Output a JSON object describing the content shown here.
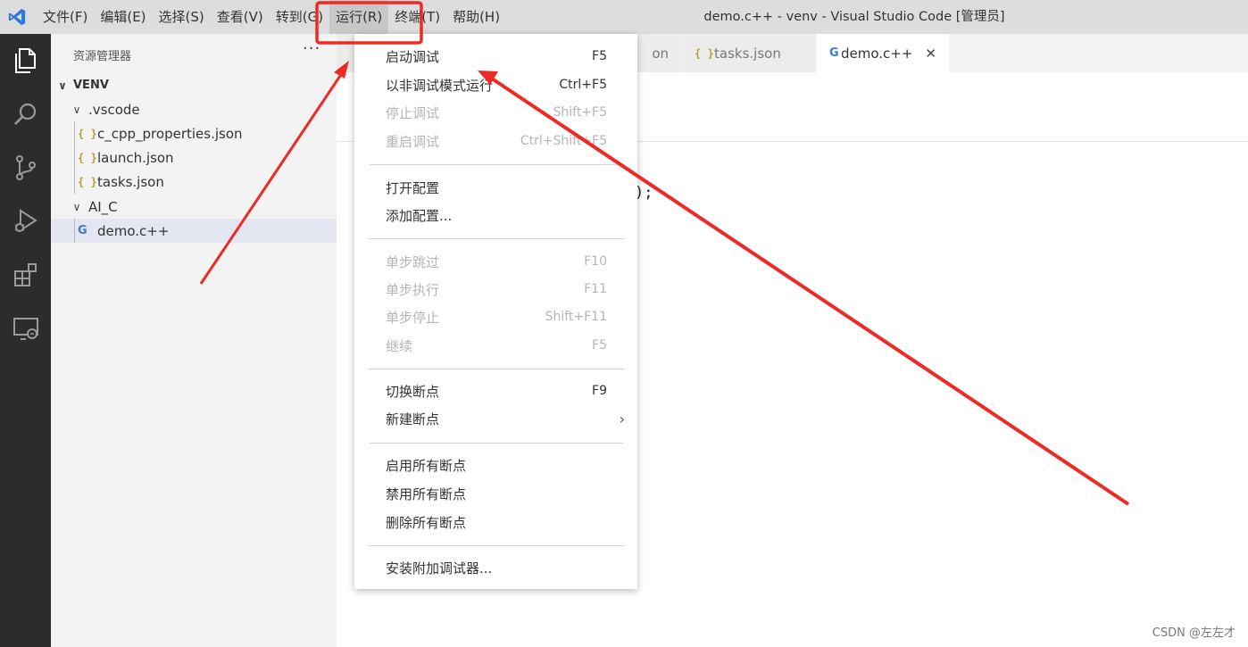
{
  "window": {
    "title": "demo.c++ - venv - Visual Studio Code [管理员]"
  },
  "menubar": {
    "items": [
      {
        "label": "文件(F)"
      },
      {
        "label": "编辑(E)"
      },
      {
        "label": "选择(S)"
      },
      {
        "label": "查看(V)"
      },
      {
        "label": "转到(G)"
      },
      {
        "label": "运行(R)"
      },
      {
        "label": "终端(T)"
      },
      {
        "label": "帮助(H)"
      }
    ]
  },
  "sidebar": {
    "header": "资源管理器",
    "more": "···",
    "tree": [
      {
        "label": "VENV"
      },
      {
        "label": ".vscode"
      },
      {
        "label": "c_cpp_properties.json"
      },
      {
        "label": "launch.json"
      },
      {
        "label": "tasks.json"
      },
      {
        "label": "AI_C"
      },
      {
        "label": "demo.c++"
      }
    ]
  },
  "tabs": [
    {
      "label": "on"
    },
    {
      "label": "tasks.json"
    },
    {
      "label": "demo.c++"
    }
  ],
  "editor": {
    "fragment": ");"
  },
  "run_menu": {
    "items": [
      {
        "label": "启动调试",
        "key": "F5"
      },
      {
        "label": "以非调试模式运行",
        "key": "Ctrl+F5"
      },
      {
        "label": "停止调试",
        "key": "Shift+F5"
      },
      {
        "label": "重启调试",
        "key": "Ctrl+Shift+F5"
      },
      {
        "label": "打开配置",
        "key": ""
      },
      {
        "label": "添加配置...",
        "key": ""
      },
      {
        "label": "单步跳过",
        "key": "F10"
      },
      {
        "label": "单步执行",
        "key": "F11"
      },
      {
        "label": "单步停止",
        "key": "Shift+F11"
      },
      {
        "label": "继续",
        "key": "F5"
      },
      {
        "label": "切换断点",
        "key": "F9"
      },
      {
        "label": "新建断点",
        "key": ""
      },
      {
        "label": "启用所有断点",
        "key": ""
      },
      {
        "label": "禁用所有断点",
        "key": ""
      },
      {
        "label": "删除所有断点",
        "key": ""
      },
      {
        "label": "安装附加调试器...",
        "key": ""
      }
    ]
  },
  "watermark": "CSDN @左左才",
  "colors": {
    "annotation": "#ee2a24",
    "accent": "#2d7ad6"
  }
}
